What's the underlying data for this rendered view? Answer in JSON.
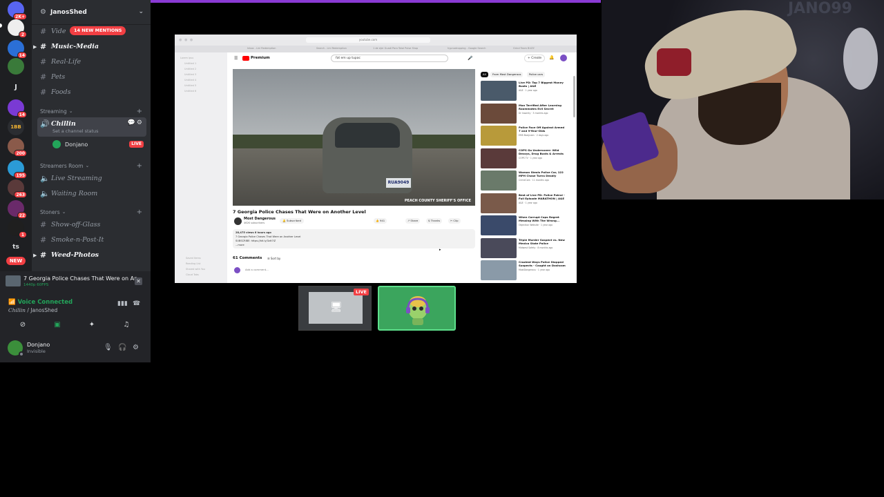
{
  "server": {
    "name": "JanosShed",
    "mentions_pill": "14 NEW MENTIONS"
  },
  "rail": {
    "badges": [
      "2K+",
      "2",
      "14",
      "",
      "J",
      "",
      "14",
      "1BB",
      "200",
      "195",
      "263",
      "22",
      "1",
      "ts"
    ],
    "new_label": "NEW"
  },
  "channels": {
    "top": [
      {
        "label": "Vide"
      },
      {
        "label": "Music-Media"
      },
      {
        "label": "Real-Life"
      },
      {
        "label": "Pets"
      },
      {
        "label": "Foods"
      }
    ],
    "category_streaming": "Streaming",
    "voice_channel": "Chillin",
    "voice_status": "Set a channel status",
    "voice_member": "Donjano",
    "live_tag": "LIVE",
    "category_streamers": "Streamers Room",
    "streamers": [
      {
        "label": "Live Streaming"
      },
      {
        "label": "Waiting Room"
      }
    ],
    "category_stoners": "Stoners",
    "stoners": [
      {
        "label": "Show-off-Glass"
      },
      {
        "label": "Smoke-n-Post-It"
      },
      {
        "label": "Weed-Photos"
      }
    ]
  },
  "stream_panel": {
    "title": "7 Georgia Police Chases That Were on An...",
    "sub": "1440p 60FPS"
  },
  "voice_panel": {
    "status": "Voice Connected",
    "channel": "Chillin",
    "server": "JanosShed"
  },
  "user": {
    "name": "Donjano",
    "status": "Invisible"
  },
  "browser": {
    "url": "youtube.com",
    "tabs": [
      "Inbox - Lini Redemption",
      "Search - Lini Redemption",
      "1 de ejer Guadi Para Total Pulse Shop",
      "hypnodropping - Google Search",
      "Grind Team BUZZ"
    ],
    "sidebar_items": [
      "Lorem ipsu",
      "Untitled 1",
      "Untitled 2",
      "Untitled 3",
      "Untitled 4",
      "Untitled 5",
      "Untitled 6"
    ],
    "sidebar_bottom": [
      "Saved Items",
      "Reading List",
      "Shared with You",
      "Cloud Tabs"
    ],
    "logo_text": "Premium",
    "search_value": "fat em up tupac",
    "create_label": "+ Create",
    "video_title": "7 Georgia Police Chases That Were on Another Level",
    "plate": "RUA9049",
    "watermark": "PEACH COUNTY SHERIFF'S OFFICE",
    "channel_name": "Most Dangerous",
    "channel_subs": "462K subscribers",
    "subscribe_label": "Subscribed",
    "actions": [
      "941",
      "Share",
      "Thanks",
      "Clip"
    ],
    "desc": [
      "28,475 views  6 hours ago",
      "7 Georgia Police Chases That Were on Another Level",
      "SUBSCRIBE: https://bit.ly/3zIt7iZ",
      "...more"
    ],
    "comments_label": "61 Comments",
    "sort_label": "Sort by",
    "add_comment": "Add a comment...",
    "chips": [
      "All",
      "From Most Dangerous",
      "Police cars"
    ],
    "recs": [
      {
        "title": "Live PD: Top 7 Biggest Money Busts | A&E",
        "meta": "A&E · 1 year ago",
        "color": "#4a5a6a"
      },
      {
        "title": "Man Terrified After Learning Roommates Evil Secret",
        "meta": "Dr Insanity · 3 months ago",
        "color": "#6b4a3a"
      },
      {
        "title": "Police Face Off Against Armed 7 and 9-Year-Olds",
        "meta": "EMS Bodycam · 2 days ago",
        "color": "#b89a3a"
      },
      {
        "title": "COPS Go Undercover: Wild Decoys, Drug Busts & Arrests",
        "meta": "COPS TV · 1 year ago",
        "color": "#5a3a3a"
      },
      {
        "title": "Woman Steals Police Car, 122 MPH Chase Turns Deadly",
        "meta": "CrimeCam · 11 months ago",
        "color": "#6a7a6a"
      },
      {
        "title": "Best of Live PD: Police Patrol - Full Episode MARATHON | A&E",
        "meta": "A&E · 1 year ago",
        "color": "#7a5a4a"
      },
      {
        "title": "When Corrupt Cops Regret Messing With The Wrong...",
        "meta": "Objection Website · 1 year ago",
        "color": "#3a4a6a"
      },
      {
        "title": "Triple Murder Suspect vs. New Mexico State Police",
        "meta": "Midwest Safety · 8 months ago",
        "color": "#4a4a5a"
      },
      {
        "title": "Craziest Ways Police Stopped Suspects - Caught on Dashcam",
        "meta": "MostDangerous · 1 year ago",
        "color": "#8a9aa8"
      }
    ]
  },
  "tiles": {
    "live_label": "LIVE"
  },
  "webcam": {
    "bg_text": "JANO99"
  }
}
